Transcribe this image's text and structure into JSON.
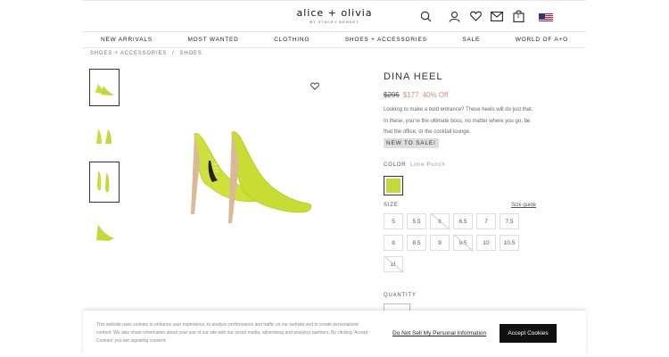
{
  "header": {
    "logo": "alice + olivia",
    "logo_sub": "BY STACEY BENDET",
    "icons": [
      "search-icon",
      "account-icon",
      "wishlist-icon",
      "mail-icon",
      "bag-icon",
      "us-flag-icon"
    ],
    "bag_count": "0"
  },
  "nav": [
    "NEW ARRIVALS",
    "MOST WANTED",
    "CLOTHING",
    "SHOES + ACCESSORIES",
    "SALE",
    "WORLD OF A+O"
  ],
  "breadcrumb": [
    "SHOES + ACCESSORIES",
    "/",
    "SHOES"
  ],
  "product": {
    "title": "DINA HEEL",
    "old_price": "$295",
    "new_price": "$177",
    "discount": "40% Off",
    "description": "Looking to make a bold entrance? These heels will do just that. In these, you're the ultimate boss, no matter where you go, be that the office, or the cocktail lounge.",
    "badge": "NEW TO SALE!",
    "color_label": "COLOR",
    "color_value": "Lime Punch",
    "color_hex": "#c3d93a",
    "size_label": "SIZE",
    "size_guide": "Size guide",
    "sizes": [
      {
        "v": "5",
        "na": false
      },
      {
        "v": "5.5",
        "na": false
      },
      {
        "v": "6",
        "na": true
      },
      {
        "v": "6.5",
        "na": false
      },
      {
        "v": "7",
        "na": false
      },
      {
        "v": "7.5",
        "na": false
      },
      {
        "v": "8",
        "na": false
      },
      {
        "v": "8.5",
        "na": false
      },
      {
        "v": "9",
        "na": false
      },
      {
        "v": "9.5",
        "na": true
      },
      {
        "v": "10",
        "na": false
      },
      {
        "v": "10.5",
        "na": false
      },
      {
        "v": "11",
        "na": true
      }
    ],
    "quantity_label": "QUANTITY"
  },
  "cookie": {
    "text": "This website uses cookies to enhance user experience, to analyze performance and traffic on our website and to create personalized content. We also share information about your use of our site with our social media, advertising and analytics partners. By clicking 'Accept Cookies' you are signaling consent.",
    "link": "Do Not Sell My Personal Information",
    "accept": "Accept Cookies"
  }
}
